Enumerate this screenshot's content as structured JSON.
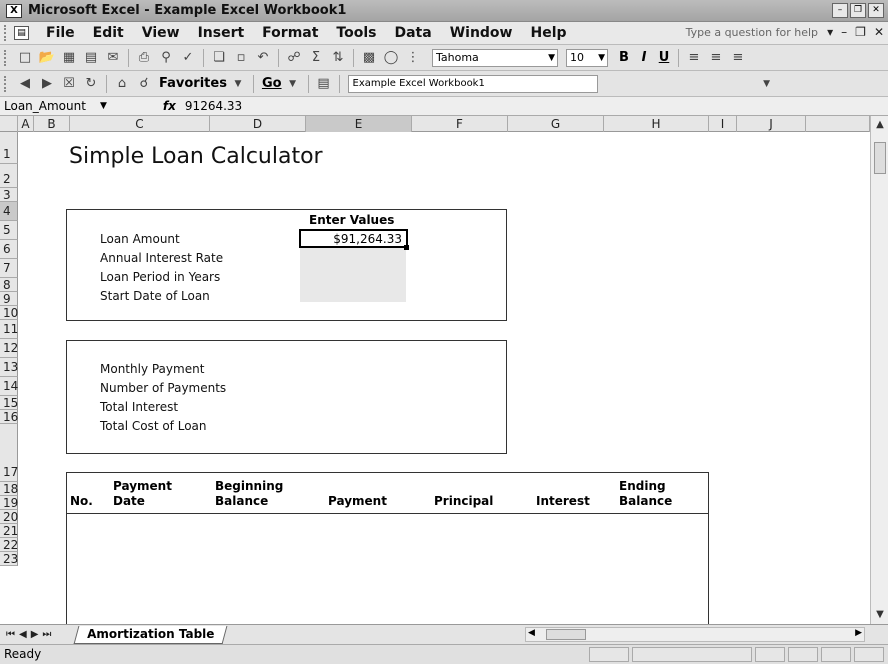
{
  "window": {
    "title": "Microsoft Excel - Example Excel Workbook1",
    "app_icon": "excel-icon"
  },
  "menu": {
    "items": [
      "File",
      "Edit",
      "View",
      "Insert",
      "Format",
      "Tools",
      "Data",
      "Window",
      "Help"
    ],
    "help_placeholder": "Type a question for help"
  },
  "toolbar": {
    "font_name": "Tahoma",
    "font_size": "10",
    "bold": "B",
    "italic": "I",
    "underline": "U"
  },
  "web_toolbar": {
    "favorites_label": "Favorites",
    "go_label": "Go",
    "address": "Example Excel Workbook1"
  },
  "formula_bar": {
    "name_box": "Loan_Amount",
    "fx_symbol": "fx",
    "formula": "91264.33"
  },
  "columns": [
    "A",
    "B",
    "C",
    "D",
    "E",
    "F",
    "G",
    "H",
    "I",
    "J"
  ],
  "selected_column": "E",
  "rows": [
    "1",
    "2",
    "3",
    "4",
    "5",
    "6",
    "7",
    "8",
    "9",
    "10",
    "11",
    "12",
    "13",
    "14",
    "15",
    "16",
    "17",
    "18",
    "19",
    "20",
    "21",
    "22",
    "23"
  ],
  "selected_row": "4",
  "sheet": {
    "title": "Simple Loan Calculator",
    "inputs_header": "Enter Values",
    "input_labels": [
      "Loan Amount",
      "Annual Interest Rate",
      "Loan Period in Years",
      "Start Date of Loan"
    ],
    "loan_amount_value": "$91,264.33",
    "output_labels": [
      "Monthly Payment",
      "Number of Payments",
      "Total Interest",
      "Total Cost of Loan"
    ],
    "table_headers": {
      "no": "No.",
      "payment_date_1": "Payment",
      "payment_date_2": "Date",
      "beginning_balance_1": "Beginning",
      "beginning_balance_2": "Balance",
      "payment": "Payment",
      "principal": "Principal",
      "interest": "Interest",
      "ending_balance_1": "Ending",
      "ending_balance_2": "Balance"
    }
  },
  "tabs": {
    "active": "Amortization Table"
  },
  "status": {
    "text": "Ready"
  }
}
